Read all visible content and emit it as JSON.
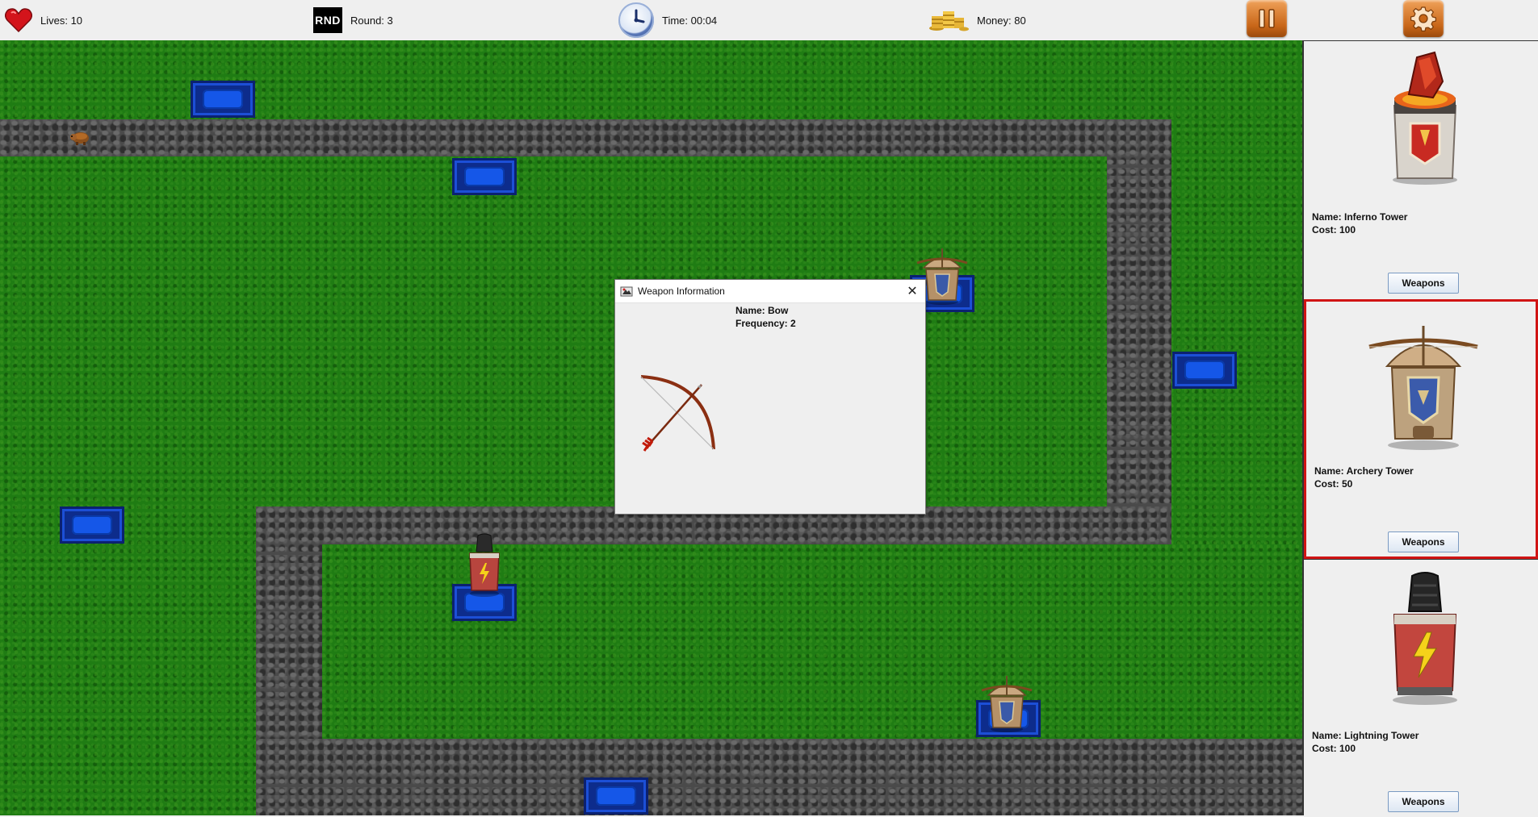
{
  "status_bar": {
    "lives_label": "Lives: 10",
    "round_badge": "RND",
    "round_label": "Round: 3",
    "time_label": "Time: 00:04",
    "money_label": "Money: 80",
    "pause_icon": "pause-icon",
    "settings_icon": "gear-icon"
  },
  "dialog": {
    "title": "Weapon Information",
    "close_glyph": "✕",
    "weapon_name": "Name: Bow",
    "weapon_frequency": "Frequency: 2",
    "weapon_icon": "bow-and-arrow-icon"
  },
  "shop": {
    "towers": [
      {
        "name": "Name: Inferno Tower",
        "cost": "Cost: 100",
        "button": "Weapons",
        "icon": "inferno-tower-icon",
        "selected": false
      },
      {
        "name": "Name: Archery Tower",
        "cost": "Cost: 50",
        "button": "Weapons",
        "icon": "archery-tower-icon",
        "selected": true
      },
      {
        "name": "Name: Lightning Tower",
        "cost": "Cost: 100",
        "button": "Weapons",
        "icon": "lightning-tower-icon",
        "selected": false
      }
    ]
  },
  "colors": {
    "grass": "#1f7c13",
    "path": "#4a4a4a",
    "slot": "#1557e8",
    "selected_border": "#d01414"
  }
}
